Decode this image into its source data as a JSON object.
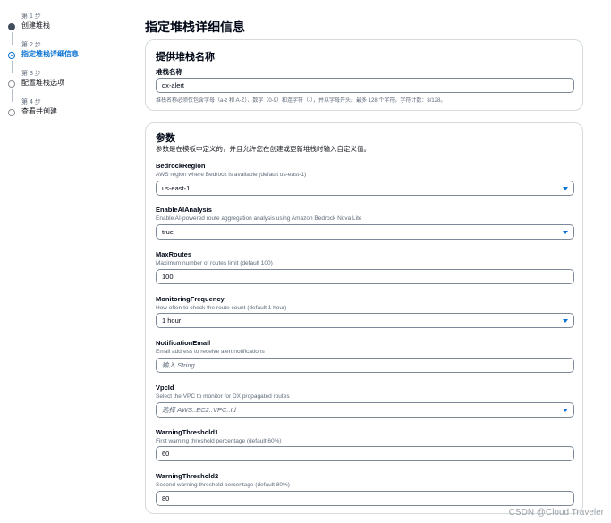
{
  "steps": [
    {
      "num": "第 1 步",
      "label": "创建堆栈",
      "state": "done"
    },
    {
      "num": "第 2 步",
      "label": "指定堆栈详细信息",
      "state": "current"
    },
    {
      "num": "第 3 步",
      "label": "配置堆栈选项",
      "state": "todo"
    },
    {
      "num": "第 4 步",
      "label": "查看并创建",
      "state": "todo"
    }
  ],
  "page_title": "指定堆栈详细信息",
  "stack_name_section": {
    "title": "提供堆栈名称",
    "label": "堆栈名称",
    "value": "dx-alert",
    "constraint": "堆栈名称必须仅包含字母（a-z 和 A-Z）、数字（0-9）和连字符（-），并以字母开头。最多 128 个字符。字符计数：8/128。"
  },
  "parameters_section": {
    "title": "参数",
    "description": "参数是在模板中定义的，并且允许您在创建或更新堆栈时输入自定义值。",
    "params": [
      {
        "name": "BedrockRegion",
        "desc": "AWS region where Bedrock is available (default us-east-1)",
        "value": "us-east-1",
        "type": "select"
      },
      {
        "name": "EnableAIAnalysis",
        "desc": "Enable AI-powered route aggregation analysis using Amazon Bedrock Nova Lite",
        "value": "true",
        "type": "select"
      },
      {
        "name": "MaxRoutes",
        "desc": "Maximum number of routes limit (default 100)",
        "value": "100",
        "type": "input"
      },
      {
        "name": "MonitoringFrequency",
        "desc": "How often to check the route count (default 1 hour)",
        "value": "1 hour",
        "type": "select"
      },
      {
        "name": "NotificationEmail",
        "desc": "Email address to receive alert notifications",
        "placeholder": "输入 String",
        "type": "input"
      },
      {
        "name": "VpcId",
        "desc": "Select the VPC to monitor for DX propagated routes",
        "placeholder": "选择 AWS::EC2::VPC::Id",
        "type": "select"
      },
      {
        "name": "WarningThreshold1",
        "desc": "First warning threshold percentage (default 60%)",
        "value": "60",
        "type": "input"
      },
      {
        "name": "WarningThreshold2",
        "desc": "Second warning threshold percentage (default 80%)",
        "value": "80",
        "type": "input"
      }
    ]
  },
  "watermark": "CSDN @Cloud Traveler",
  "colors": {
    "accent": "#0972d3",
    "text": "#000716",
    "muted": "#5f6b7a",
    "border": "#7d8998"
  }
}
